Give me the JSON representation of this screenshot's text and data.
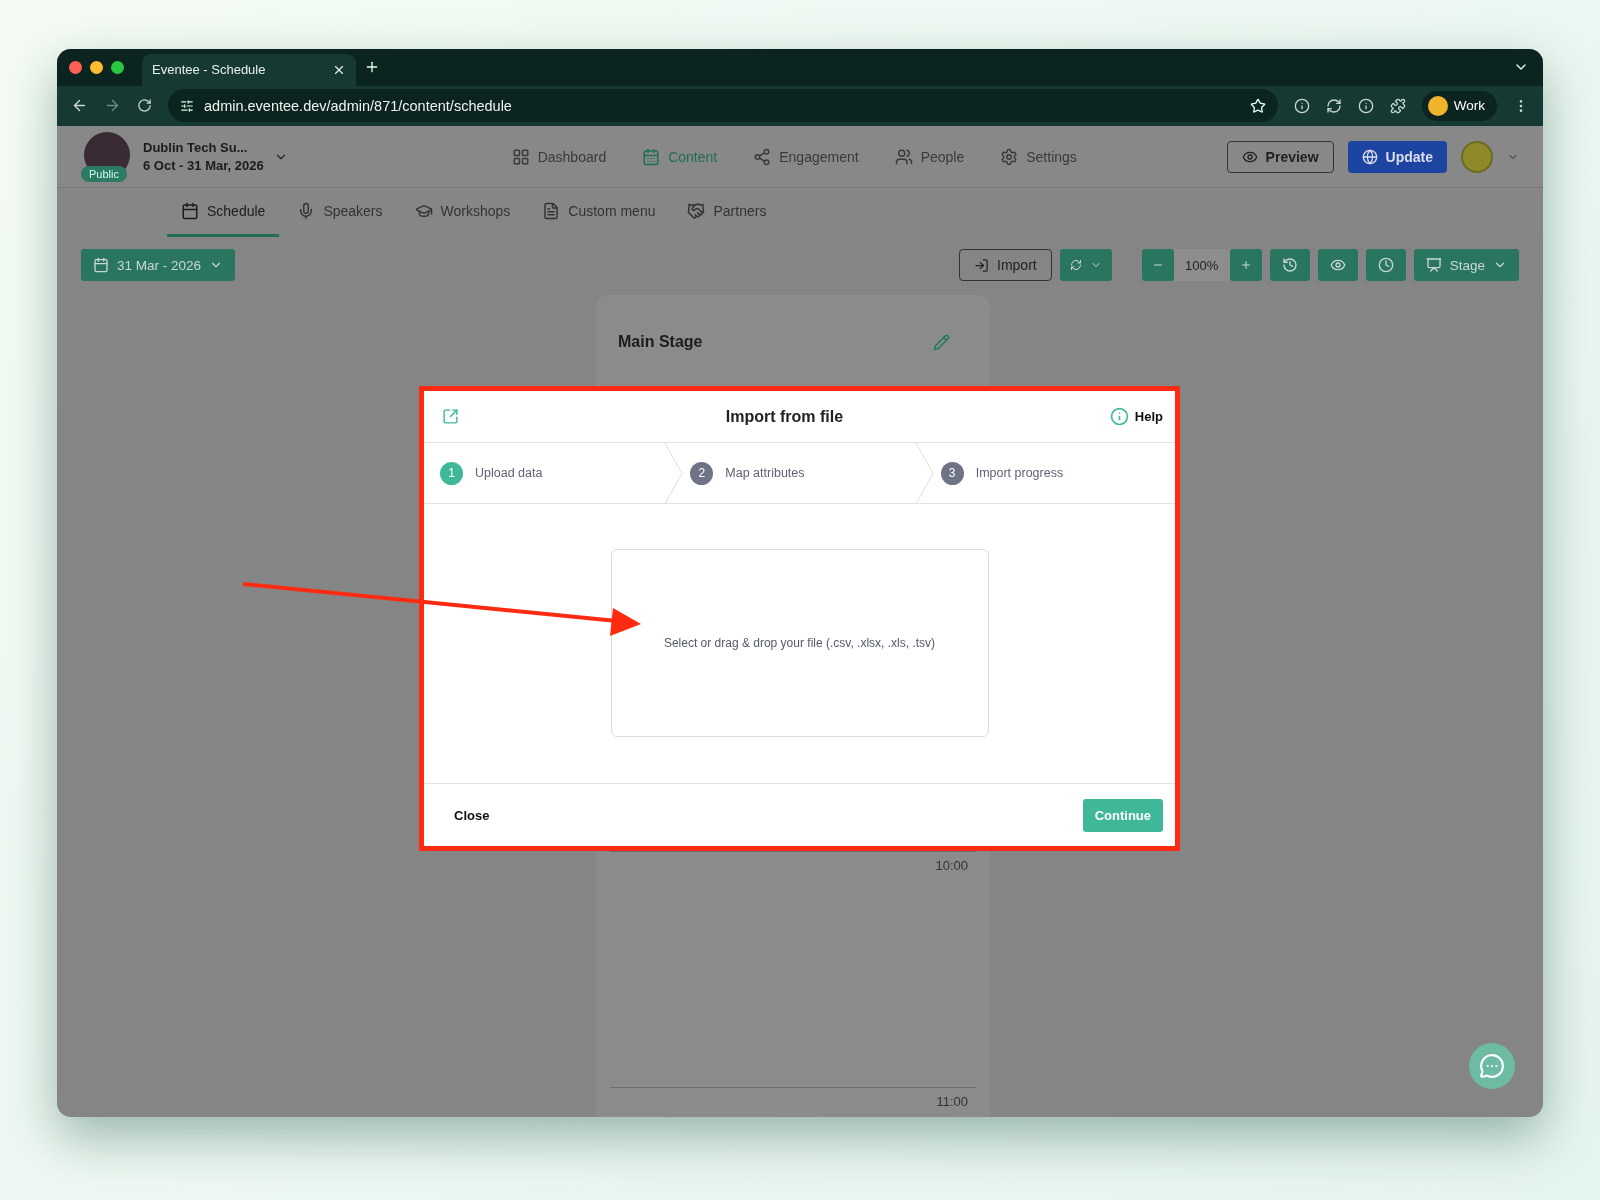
{
  "browser": {
    "tab_title": "Eventee - Schedule",
    "url": "admin.eventee.dev/admin/871/content/schedule",
    "profile": "Work"
  },
  "event": {
    "badge": "Public",
    "name": "Dublin Tech Su...",
    "dates": "6 Oct - 31 Mar, 2026"
  },
  "nav": [
    {
      "label": "Dashboard",
      "selected": false
    },
    {
      "label": "Content",
      "selected": true
    },
    {
      "label": "Engagement",
      "selected": false
    },
    {
      "label": "People",
      "selected": false
    },
    {
      "label": "Settings",
      "selected": false
    }
  ],
  "header_buttons": {
    "preview": "Preview",
    "update": "Update"
  },
  "subnav": [
    {
      "label": "Schedule",
      "selected": true
    },
    {
      "label": "Speakers",
      "selected": false
    },
    {
      "label": "Workshops",
      "selected": false
    },
    {
      "label": "Custom menu",
      "selected": false
    },
    {
      "label": "Partners",
      "selected": false
    }
  ],
  "toolbar": {
    "date": "31 Mar - 2026",
    "import": "Import",
    "zoom": "100%",
    "view": "Stage"
  },
  "schedule": {
    "stage": "Main Stage",
    "times": [
      "10:00",
      "11:00"
    ]
  },
  "modal": {
    "title": "Import from file",
    "help": "Help",
    "steps": [
      {
        "number": "1",
        "label": "Upload data",
        "selected": true
      },
      {
        "number": "2",
        "label": "Map attributes",
        "selected": false
      },
      {
        "number": "3",
        "label": "Import progress",
        "selected": false
      }
    ],
    "dropzone": "Select or drag & drop your file (.csv, .xlsx, .xls, .tsv)",
    "close": "Close",
    "continue": "Continue"
  }
}
